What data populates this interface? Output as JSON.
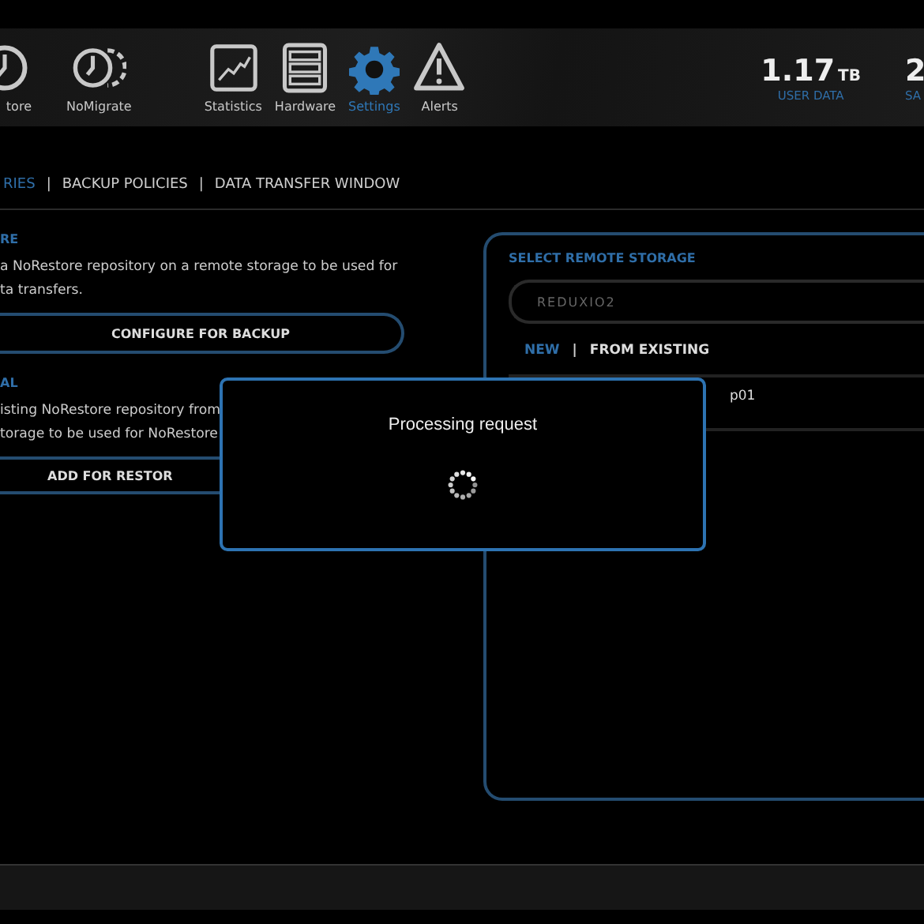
{
  "nav": [
    {
      "label": "tore",
      "kind": "restore",
      "selected": false
    },
    {
      "label": "NoMigrate",
      "kind": "migrate",
      "selected": false
    },
    {
      "label": "Statistics",
      "kind": "chart",
      "selected": false
    },
    {
      "label": "Hardware",
      "kind": "server",
      "selected": false
    },
    {
      "label": "Settings",
      "kind": "gear",
      "selected": true
    },
    {
      "label": "Alerts",
      "kind": "alert",
      "selected": false
    }
  ],
  "stats": [
    {
      "value": "1.17",
      "unit": "TB",
      "label": "USER DATA"
    },
    {
      "value": "2",
      "label": "SA"
    }
  ],
  "subtabs": {
    "separator": "|",
    "items": [
      {
        "label": "RIES",
        "selected": true
      },
      {
        "label": "BACKUP POLICIES",
        "selected": false
      },
      {
        "label": "DATA TRANSFER WINDOW",
        "selected": false
      }
    ]
  },
  "sections": [
    {
      "heading": "RE",
      "lines": [
        "a NoRestore repository on a remote storage to be used for",
        "ta transfers."
      ],
      "button": "CONFIGURE FOR BACKUP"
    },
    {
      "heading": "AL",
      "lines": [
        "isting NoRestore repository from",
        "torage to be used for NoRestore"
      ],
      "button": "ADD FOR RESTOR"
    }
  ],
  "remote_storage": {
    "heading": "SELECT REMOTE STORAGE",
    "value": "REDUXIO2",
    "separator": "|",
    "modes": [
      {
        "label": "NEW",
        "selected": true
      },
      {
        "label": "FROM EXISTING",
        "selected": false
      }
    ],
    "items": [
      "p01"
    ]
  },
  "dialog": {
    "message": "Processing request"
  }
}
